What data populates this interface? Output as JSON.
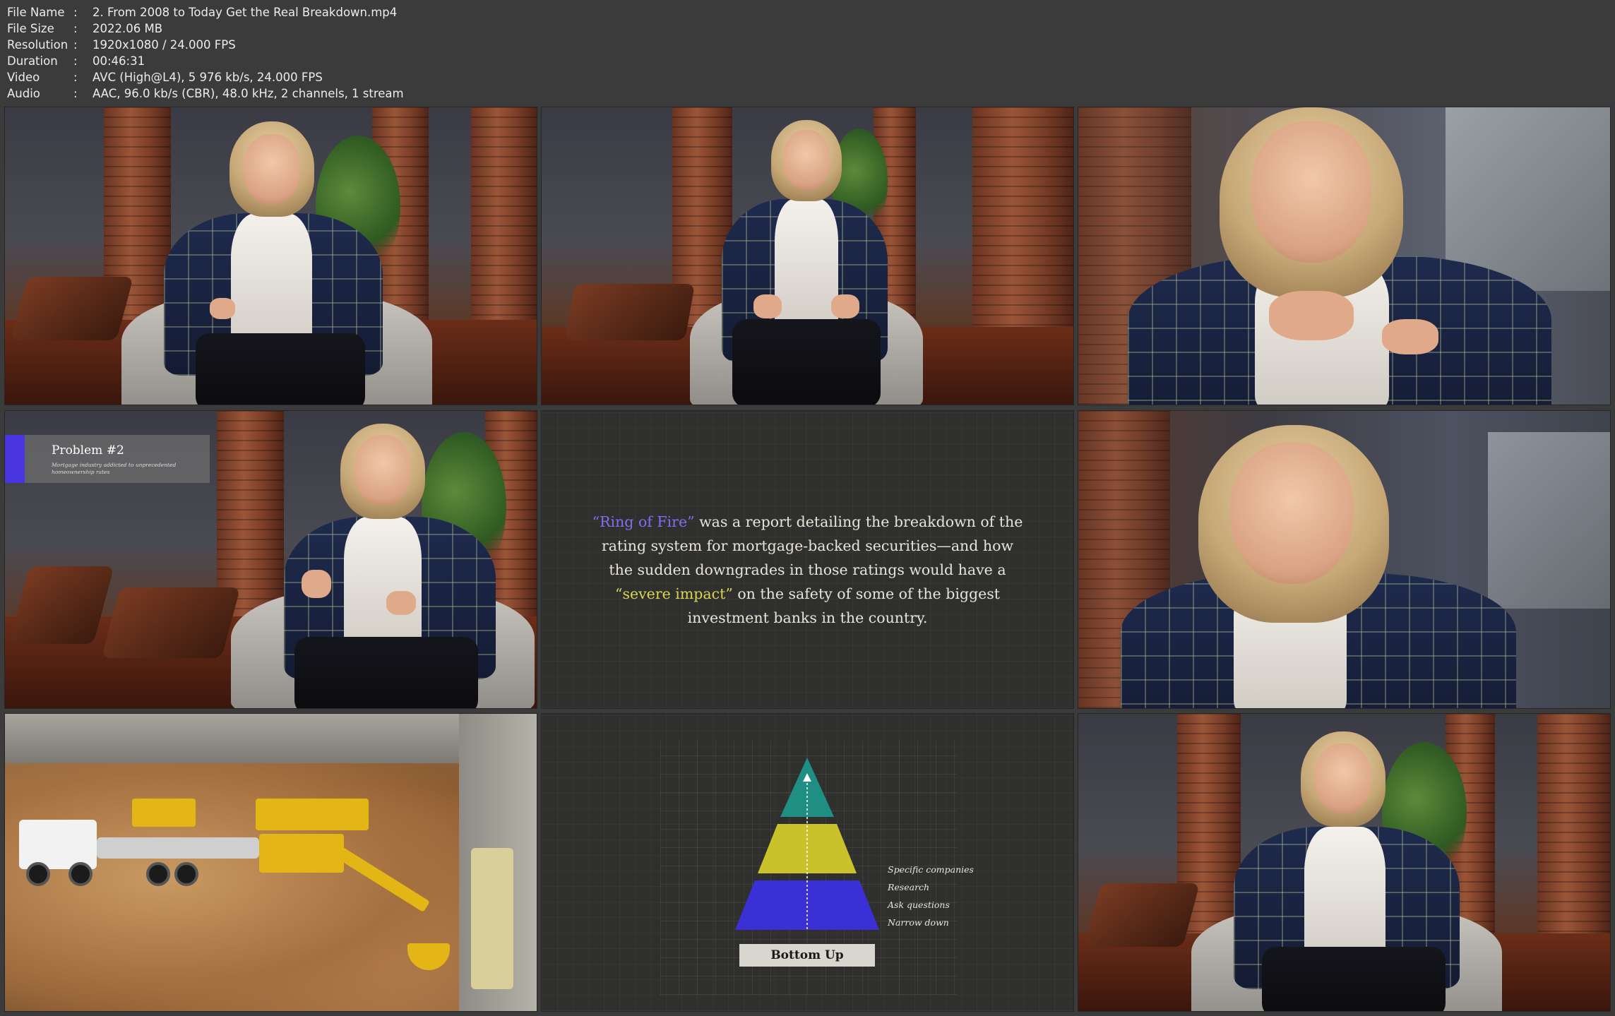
{
  "meta": {
    "rows": [
      {
        "key": "File Name",
        "value": "2. From 2008 to Today Get the Real Breakdown.mp4"
      },
      {
        "key": "File Size",
        "value": "2022.06 MB"
      },
      {
        "key": "Resolution",
        "value": "1920x1080 / 24.000 FPS"
      },
      {
        "key": "Duration",
        "value": "00:46:31"
      },
      {
        "key": "Video",
        "value": "AVC (High@L4), 5 976 kb/s, 24.000 FPS"
      },
      {
        "key": "Audio",
        "value": "AAC, 96.0 kb/s (CBR), 48.0 kHz, 2 channels, 1 stream"
      }
    ],
    "separator": ":"
  },
  "problem_tag": {
    "title": "Problem #2",
    "subtitle": "Mortgage industry addicted to unprecedented homeownership rates"
  },
  "quote": {
    "part1": "“Ring of Fire”",
    "part2": " was a report detailing the breakdown of the rating system for mortgage-backed securities—and how the sudden downgrades in those ratings would have a ",
    "part3": "“severe impact”",
    "part4": " on the safety of some of the biggest investment banks in the country."
  },
  "pyramid": {
    "labels": [
      "Specific companies",
      "Research",
      "Ask questions",
      "Narrow down"
    ],
    "button": "Bottom Up",
    "colors": {
      "top": "#1f8f84",
      "middle": "#c9c22a",
      "bottom": "#3b2fd6"
    }
  },
  "colors": {
    "background": "#3b3b3b",
    "accent_purple": "#7f6ef0",
    "accent_yellow": "#d7d552",
    "tag_bar": "#4a36e0"
  }
}
